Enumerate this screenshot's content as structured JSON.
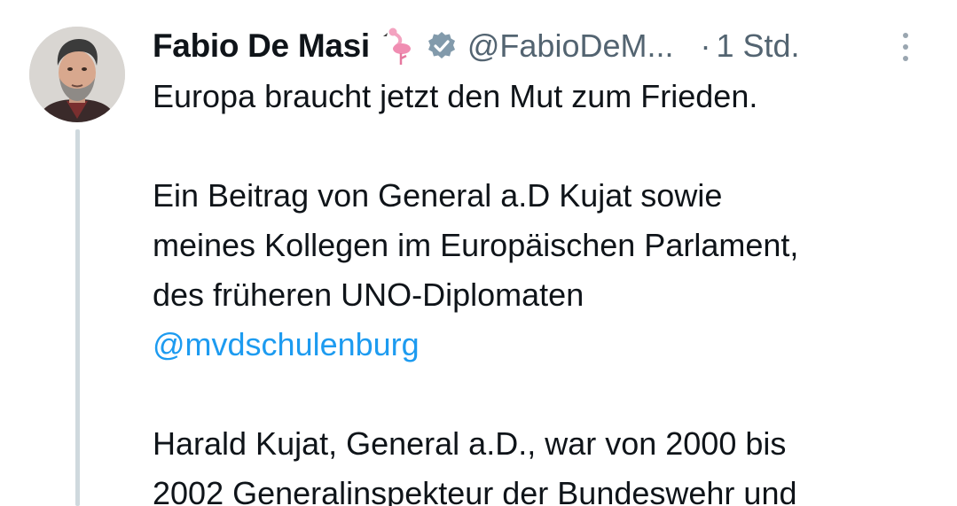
{
  "author": {
    "name": "Fabio De Masi",
    "handle": "@FabioDeM...",
    "time": "1 Std.",
    "separator": "·"
  },
  "icons": {
    "avatar": "profile-photo",
    "emoji": "flamingo-emoji",
    "badge": "verified-badge",
    "menu": "more-options-vertical-dots"
  },
  "colors": {
    "text": "#0f1419",
    "secondary": "#536471",
    "link": "#1d9bf0",
    "thread_line": "#cfd9de",
    "verified_badge": "#829aab"
  },
  "tweet": {
    "line1": "Europa braucht jetzt den Mut zum Frieden.",
    "line2": "Ein Beitrag von General a.D Kujat sowie",
    "line3": "meines Kollegen im Europäischen Parlament,",
    "line4": "des früheren UNO-Diplomaten",
    "mention": "@mvdschulenburg",
    "line5": "Harald Kujat, General a.D., war von 2000 bis",
    "line6": "2002 Generalinspekteur der Bundeswehr und"
  }
}
